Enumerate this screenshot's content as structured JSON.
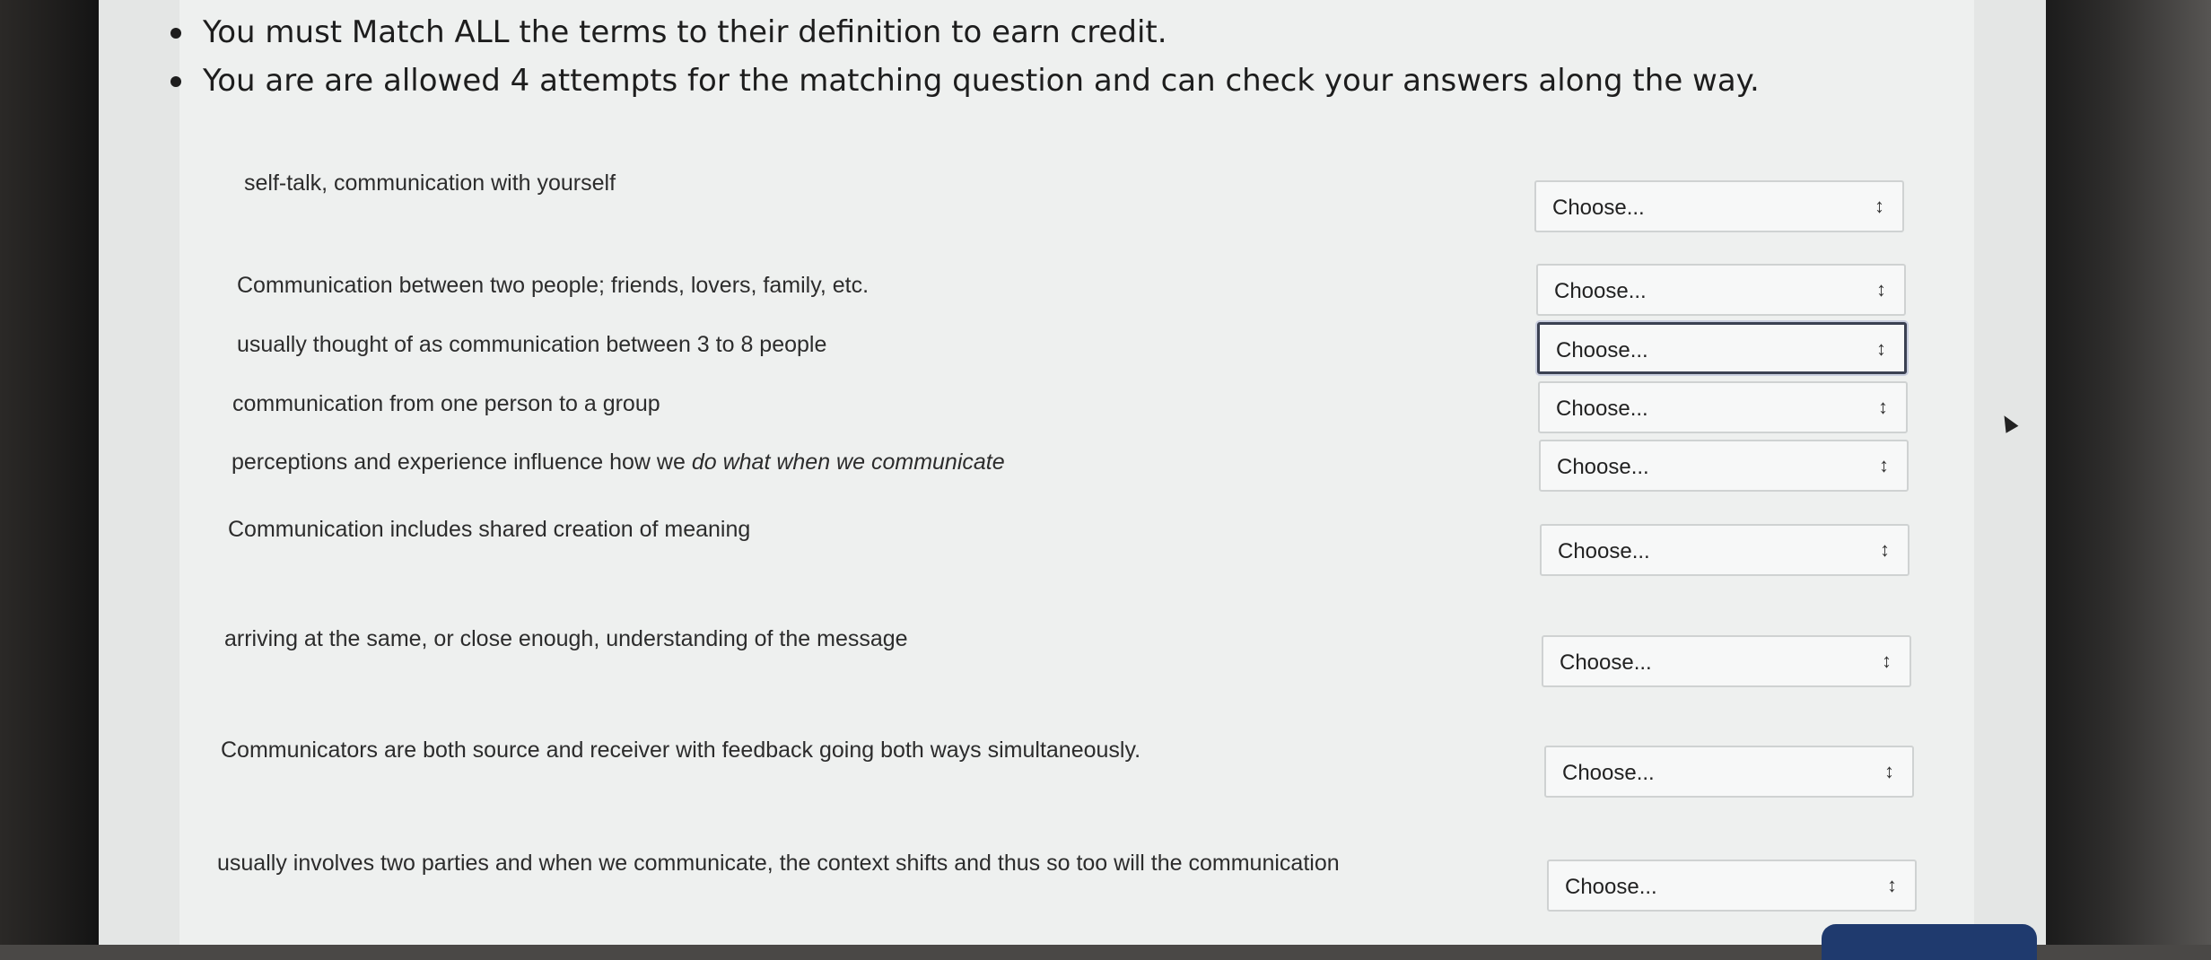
{
  "instructions": [
    "You must Match ALL the terms to their definition to earn credit.",
    "You are are allowed 4 attempts for the matching question and can check your answers along the way."
  ],
  "matching": {
    "placeholder": "Choose...",
    "items": [
      {
        "term": "self-talk, communication with yourself",
        "selected": "Choose..."
      },
      {
        "term": "Communication between two people; friends, lovers, family, etc.",
        "selected": "Choose..."
      },
      {
        "term": "usually thought of as communication between 3 to 8 people",
        "selected": "Choose..."
      },
      {
        "term": "communication from one person to a group",
        "selected": "Choose..."
      },
      {
        "term_prefix": "perceptions and experience influence how we ",
        "term_emphasis": "do what when we communicate",
        "selected": "Choose..."
      },
      {
        "term": "Communication includes shared creation of meaning",
        "selected": "Choose..."
      },
      {
        "term": "arriving at the same, or close enough, understanding of the message",
        "selected": "Choose..."
      },
      {
        "term": "Communicators are both source and receiver with feedback going both ways simultaneously.",
        "selected": "Choose..."
      },
      {
        "term": "usually involves two parties and when we communicate, the context shifts and thus so too will the communication",
        "selected": "Choose..."
      }
    ]
  },
  "icons": {
    "select_arrow": "updown-arrows-icon",
    "cursor": "mouse-pointer-icon"
  },
  "colors": {
    "focus_border": "#3b4152",
    "button": "#1f3a6e"
  }
}
